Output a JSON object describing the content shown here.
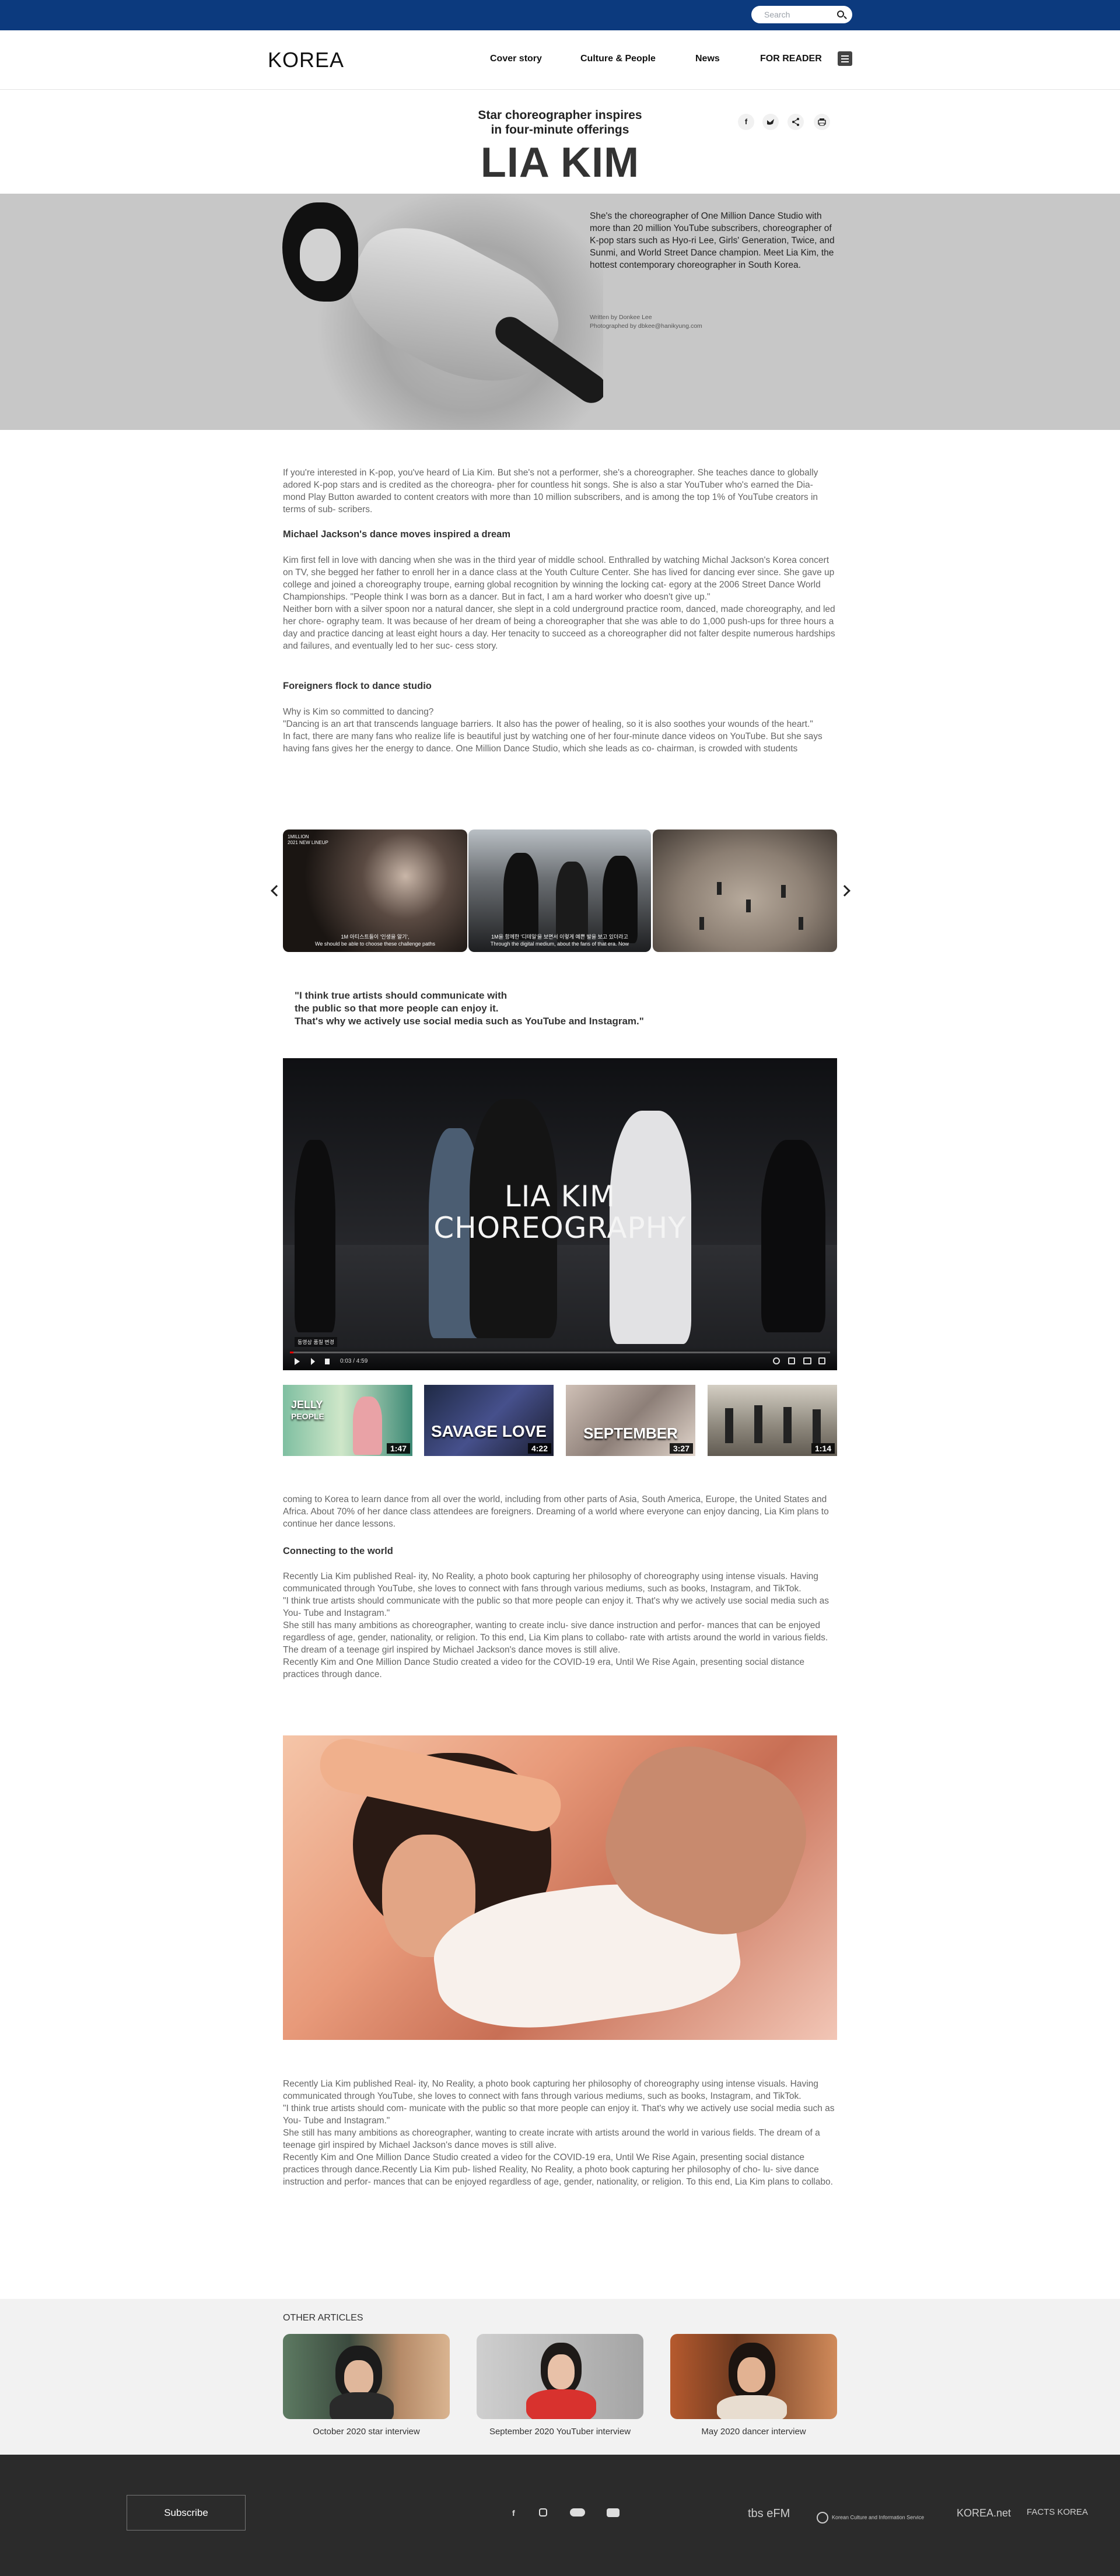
{
  "topbar": {
    "search_placeholder": "Search"
  },
  "header": {
    "logo": "KOREA",
    "nav": [
      "Cover story",
      "Culture & People",
      "News",
      "FOR READER"
    ]
  },
  "hero": {
    "kicker_line1": "Star choreographer inspires",
    "kicker_line2": "in four-minute offerings",
    "title": "LIA KIM",
    "share": [
      "f",
      "t",
      "share",
      "print"
    ],
    "intro": "She's the choreographer of One Million Dance Studio with more than 20 million YouTube subscribers, choreographer of K-pop stars such as Hyo-ri Lee, Girls' Generation, Twice, and Sunmi, and World Street Dance champion. Meet Lia Kim, the hottest contemporary choreographer in South Korea.",
    "written_by": "Written by Donkee Lee",
    "photographed_by": "Photographed by dbkee@hanikyung.com"
  },
  "article": {
    "p1": "If you're interested in K-pop, you've heard of Lia Kim. But she's not a performer, she's a choreographer. She teaches dance to globally adored K-pop stars and is credited as the choreogra- pher for countless hit songs. She is also a star YouTuber who's earned the Dia- mond Play Button awarded to content creators with more than 10 million subscribers, and is among the top 1% of YouTube creators in terms of sub- scribers.",
    "h1": "Michael Jackson's dance moves inspired a dream",
    "p2a": "Kim first fell in love with dancing when she was in the third year of middle school. Enthralled by watching Michal Jackson's Korea concert on TV, she begged her father to enroll her in a dance class at the Youth Culture Center. She has lived for dancing ever since. She gave up college and joined a choreography troupe, earning global recognition by winning the locking cat- egory at the 2006 Street Dance World Championships. \"People think I was born as a dancer. But in fact, I am a hard worker who doesn't give up.\"",
    "p2b": "Neither born with a silver spoon nor a natural dancer, she slept in a cold underground practice room, danced, made choreography, and led her chore- ography team. It was because of her dream of being a choreographer that she was able to do 1,000 push-ups for three hours a day and practice dancing at least eight hours a day. Her tenacity to succeed as a choreographer did not falter despite numerous hardships and failures, and eventually led to her suc- cess story.",
    "h2": "Foreigners flock to dance studio",
    "p3a": "Why is Kim so committed to dancing?",
    "p3b": "\"Dancing is an art that transcends language barriers. It also has the power of healing, so it is also soothes your wounds of the heart.\"",
    "p3c": "In fact, there are many fans who realize life is beautiful just by watching one of her four-minute dance videos on YouTube. But she says having fans gives her the energy to dance. One Million Dance Studio, which she leads as co- chairman, is crowded with students",
    "slides": [
      {
        "tag": "1MILLION\n2021 NEW LINEUP",
        "caption": "1M 아티스트들이 '인생을 알기',\nWe should be able to choose these challenge paths"
      },
      {
        "caption": "1M을 함께한 '디테일'을 보면서 이렇게 예쁜 발을 보고 있더라고\nThrough the digital medium, about the fans of that era. Now"
      },
      {
        "caption": ""
      }
    ],
    "quote_l1": "\"I think true artists should communicate with",
    "quote_l2": "the public so that more people can enjoy it.",
    "quote_l3": "That's why we actively use social media such as YouTube and Instagram.\"",
    "video": {
      "title_l1": "LIA KIM",
      "title_l2": "CHOREOGRAPHY",
      "chip": "동영상 품질 변경",
      "time": "0:03 / 4:59",
      "progress": 0.006
    },
    "thumbs": [
      {
        "title": "JELLY",
        "sub": "PEOPLE",
        "duration": "1:47"
      },
      {
        "title": "SAVAGE LOVE",
        "sub": "",
        "duration": "4:22"
      },
      {
        "title": "SEPTEMBER",
        "sub": "",
        "duration": "3:27"
      },
      {
        "title": "",
        "sub": "",
        "duration": "1:14"
      }
    ],
    "p4": "coming to Korea to learn dance from all over the world, including from other parts of Asia, South America, Europe, the United States and Africa. About 70% of her dance class attendees are foreigners. Dreaming of a world where everyone can enjoy dancing, Lia Kim plans to continue her dance lessons.",
    "h3": "Connecting to the world",
    "p5a": "Recently Lia Kim published Real- ity, No Reality, a photo book capturing her philosophy of choreography using intense visuals. Having communicated through YouTube, she loves to connect with fans through various mediums, such as books, Instagram, and TikTok.",
    "p5b": "\"I think true artists should communicate with the public so that more people can enjoy it. That's why we actively use social media such as You- Tube and Instagram.\"",
    "p5c": "She still has many ambitions as choreographer, wanting to create inclu- sive dance instruction and perfor- mances that can be enjoyed regardless of age, gender, nationality, or religion. To this end, Lia Kim plans to collabo- rate with artists around the world in various fields. The dream of a teenage girl inspired by Michael Jackson's dance moves is still alive.",
    "p5d": "Recently Kim and One Million Dance Studio created a video for the COVID-19 era, Until We Rise Again, presenting social distance practices through dance.",
    "p6a": "Recently Lia Kim published Real- ity, No Reality, a photo book capturing her philosophy of choreography using intense visuals. Having communicated through YouTube, she loves to connect with fans through various mediums, such as books, Instagram, and TikTok.",
    "p6b": "\"I think true artists should com- municate with the public so that more people can enjoy it. That's why we actively use social media such as You- Tube and Instagram.\"",
    "p6c": "She still has many ambitions as choreographer, wanting to create incrate with artists around the world in various fields. The dream of a teenage girl inspired by Michael Jackson's dance moves is still alive.",
    "p6d": "Recently Kim and One Million Dance Studio created a video for the COVID-19 era, Until We Rise Again, presenting social distance practices through dance.Recently Lia Kim pub- lished Reality, No Reality, a photo book capturing her philosophy of cho- lu- sive dance instruction and perfor- mances that can be enjoyed regardless of age, gender, nationality, or religion. To this end, Lia Kim plans to collabo."
  },
  "others": {
    "heading": "OTHER ARTICLES",
    "cards": [
      {
        "caption": "October 2020 star interview"
      },
      {
        "caption": "September 2020 YouTuber interview"
      },
      {
        "caption": "May 2020 dancer interview"
      }
    ]
  },
  "footer": {
    "subscribe": "Subscribe",
    "social": [
      "f",
      "ig",
      "fl",
      "yt"
    ],
    "logos": [
      "tbs eFM",
      "Korean Culture and Information Service",
      "KOREA.net",
      "FACTS KOREA"
    ]
  },
  "colors": {
    "topbar": "#0c3a7e",
    "footer": "#2b2b2b",
    "hero_bg": "#c7c7c7"
  }
}
